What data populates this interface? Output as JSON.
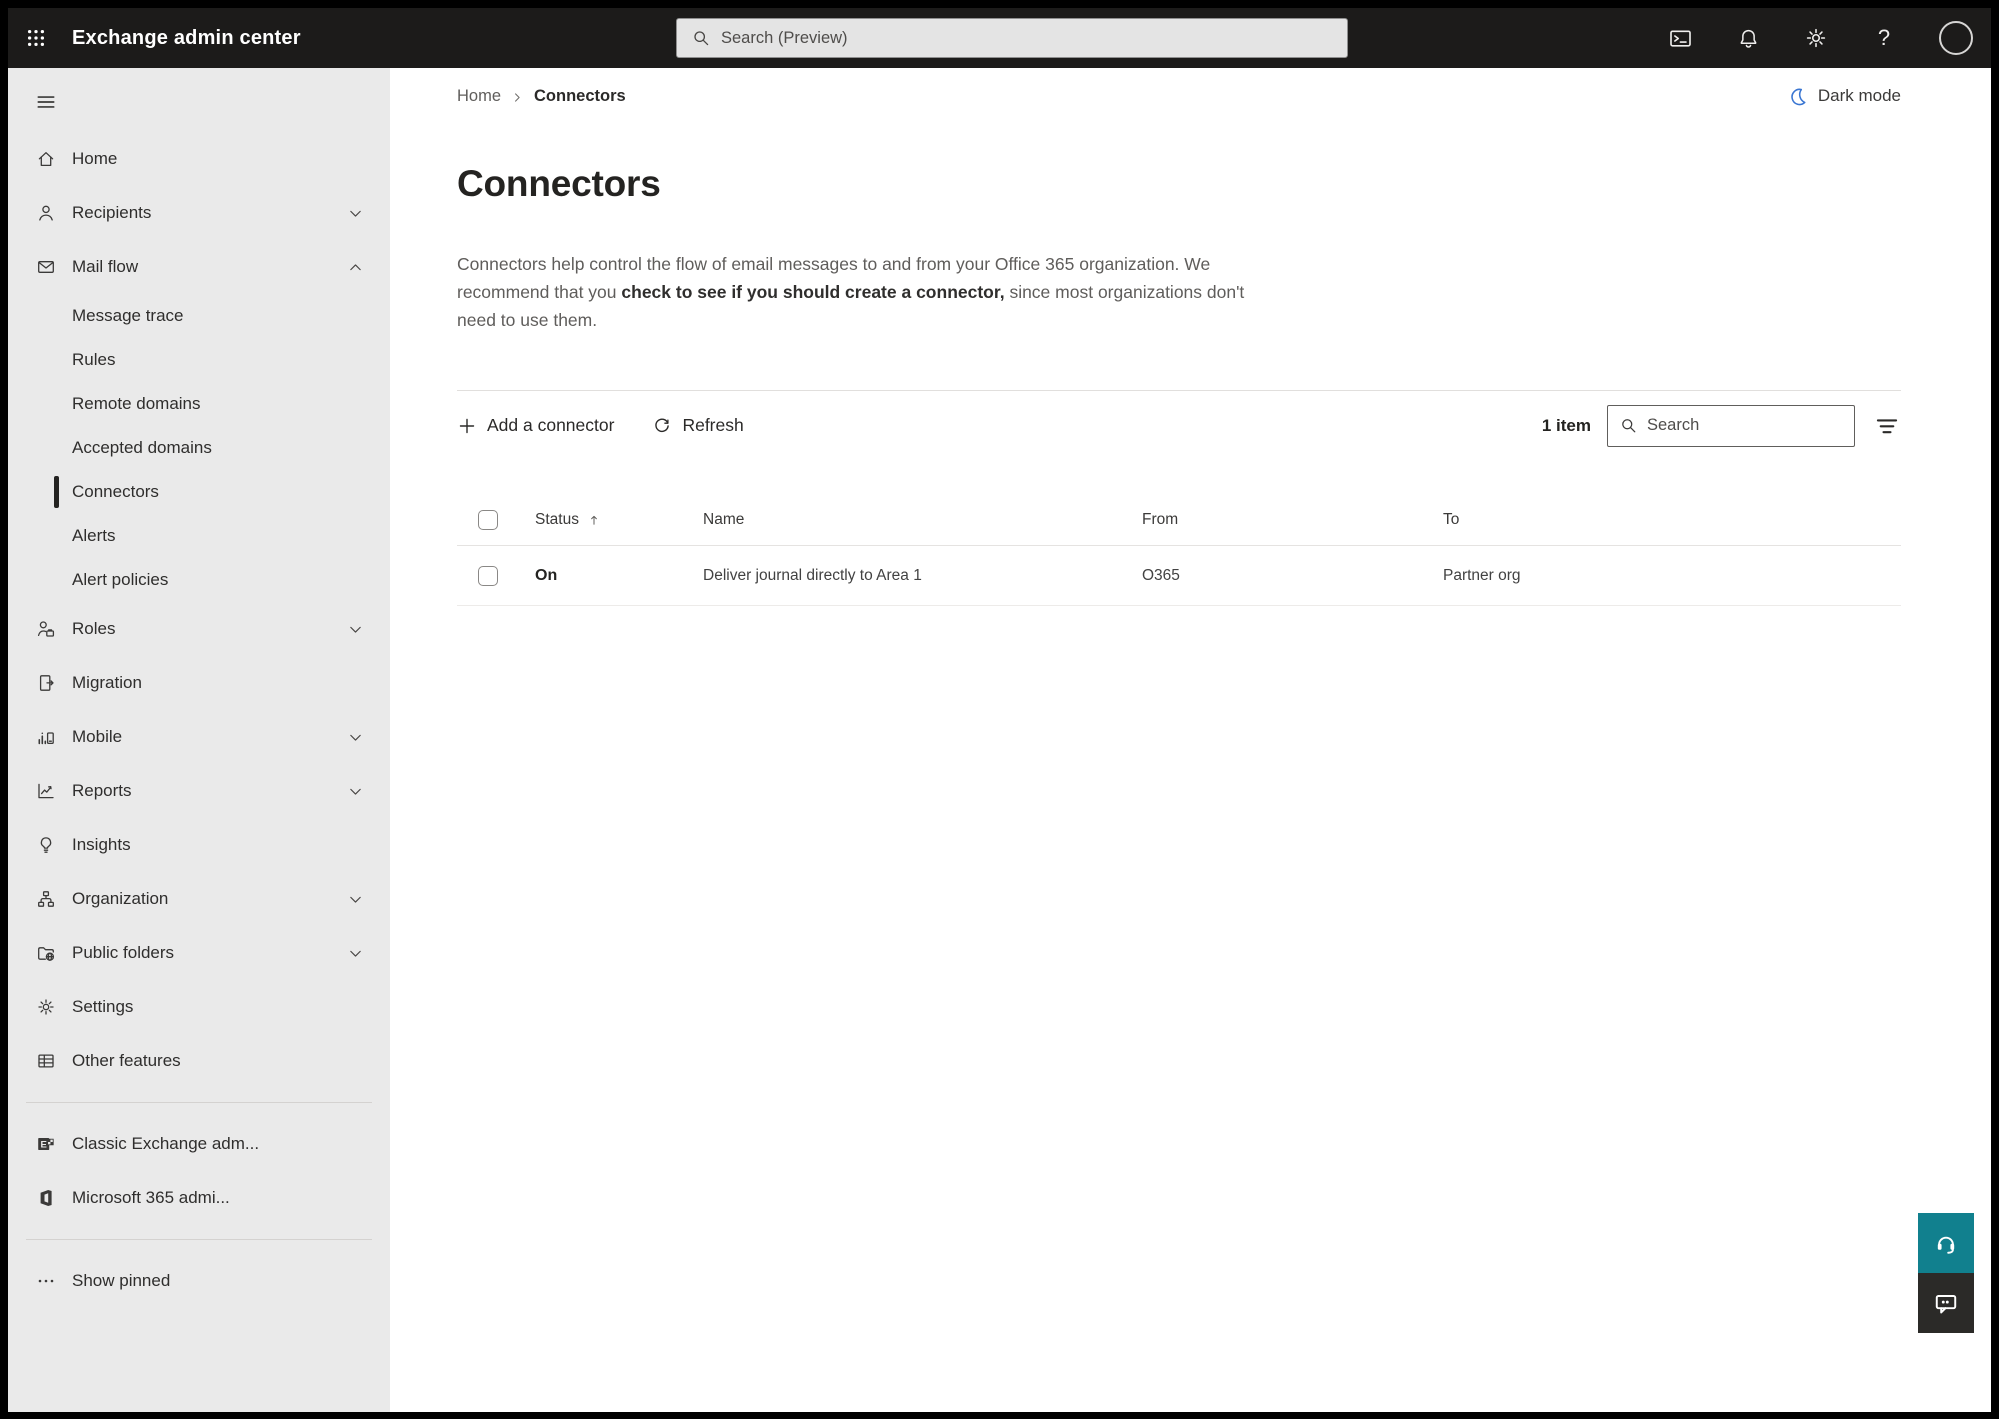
{
  "topbar": {
    "app_title": "Exchange admin center",
    "search_placeholder": "Search (Preview)"
  },
  "sidebar": {
    "items": [
      {
        "label": "Home",
        "icon": "home"
      },
      {
        "label": "Recipients",
        "icon": "person",
        "chevron": "down"
      },
      {
        "label": "Mail flow",
        "icon": "mail",
        "chevron": "up"
      },
      {
        "label": "Message trace",
        "sub": true
      },
      {
        "label": "Rules",
        "sub": true
      },
      {
        "label": "Remote domains",
        "sub": true
      },
      {
        "label": "Accepted domains",
        "sub": true
      },
      {
        "label": "Connectors",
        "sub": true,
        "selected": true
      },
      {
        "label": "Alerts",
        "sub": true
      },
      {
        "label": "Alert policies",
        "sub": true
      },
      {
        "label": "Roles",
        "icon": "person-briefcase",
        "chevron": "down"
      },
      {
        "label": "Migration",
        "icon": "migration"
      },
      {
        "label": "Mobile",
        "icon": "mobile",
        "chevron": "down"
      },
      {
        "label": "Reports",
        "icon": "reports",
        "chevron": "down"
      },
      {
        "label": "Insights",
        "icon": "insights"
      },
      {
        "label": "Organization",
        "icon": "organization",
        "chevron": "down"
      },
      {
        "label": "Public folders",
        "icon": "public-folders",
        "chevron": "down"
      },
      {
        "label": "Settings",
        "icon": "gear"
      },
      {
        "label": "Other features",
        "icon": "table"
      }
    ],
    "footer_items": [
      {
        "label": "Classic Exchange adm...",
        "icon": "exchange-logo"
      },
      {
        "label": "Microsoft 365 admi...",
        "icon": "m365-logo"
      }
    ],
    "show_pinned_label": "Show pinned"
  },
  "main": {
    "breadcrumb": {
      "root": "Home",
      "current": "Connectors"
    },
    "dark_mode_label": "Dark mode",
    "page_title": "Connectors",
    "description": {
      "part1": "Connectors help control the flow of email messages to and from your Office 365 organization. We recommend that you ",
      "emphasis": "check to see if you should create a connector,",
      "part2": " since most organizations don't need to use them."
    },
    "toolbar": {
      "add_button": "Add a connector",
      "refresh_button": "Refresh",
      "item_count": "1 item",
      "search_placeholder": "Search"
    },
    "table": {
      "columns": [
        {
          "label": "Status",
          "sorted": "asc"
        },
        {
          "label": "Name"
        },
        {
          "label": "From"
        },
        {
          "label": "To"
        }
      ],
      "rows": [
        {
          "status": "On",
          "name": "Deliver journal directly to Area 1",
          "from": "O365",
          "to": "Partner org"
        }
      ]
    }
  },
  "colors": {
    "topbar_bg": "#1c1b1a",
    "sidebar_bg": "#eaeaea",
    "moon_blue": "#3a76d2",
    "support_teal": "#11808e",
    "feedback_dark": "#2b2a28"
  }
}
